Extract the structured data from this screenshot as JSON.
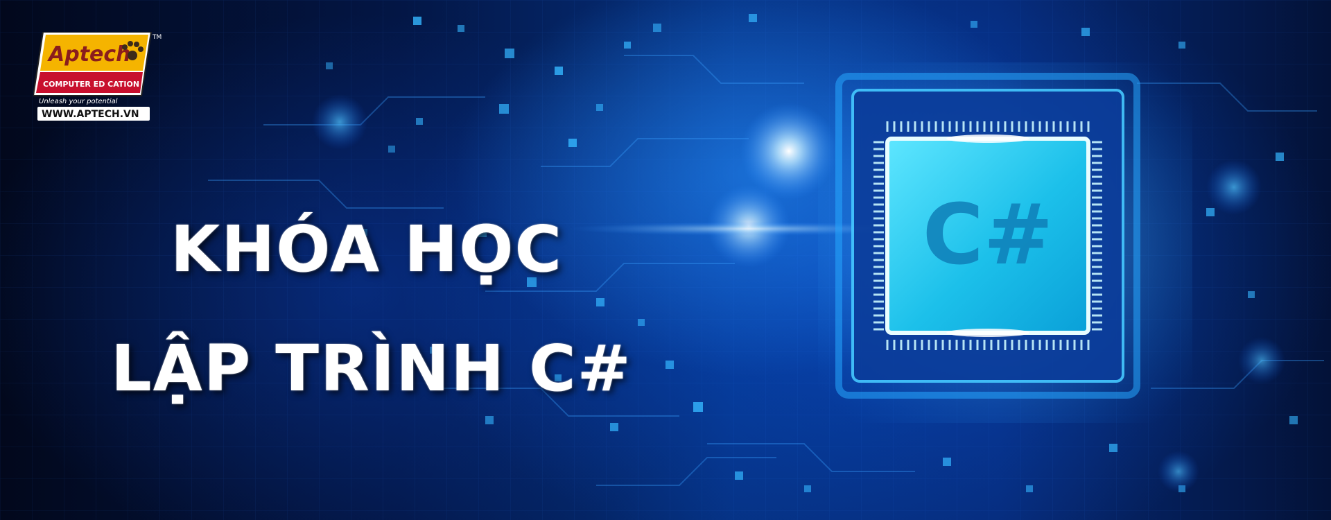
{
  "logo": {
    "brand": "Aptech",
    "subtitle": "COMPUTER ED  CATION",
    "tagline": "Unleash your potential",
    "trademark": "TM",
    "website": "WWW.APTECH.VN"
  },
  "headline": {
    "line1": "KHÓA HỌC",
    "line2": "LẬP TRÌNH C#"
  },
  "chip": {
    "label": "C#"
  },
  "colors": {
    "accent": "#17d3f0",
    "background": "#031645",
    "logo_red": "#c8102e",
    "logo_yellow": "#f5b400"
  }
}
